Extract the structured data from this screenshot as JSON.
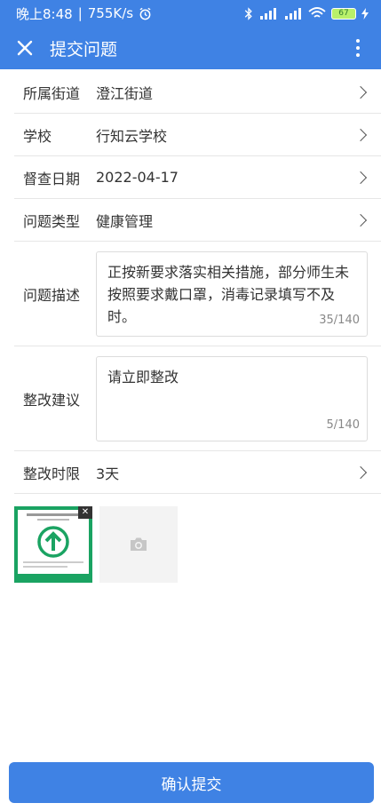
{
  "status_bar": {
    "time": "晚上8:48",
    "speed": "755K/s",
    "battery": "67"
  },
  "header": {
    "title": "提交问题"
  },
  "form": {
    "street": {
      "label": "所属街道",
      "value": "澄江街道"
    },
    "school": {
      "label": "学校",
      "value": "行知云学校"
    },
    "date": {
      "label": "督查日期",
      "value": "2022-04-17"
    },
    "type": {
      "label": "问题类型",
      "value": "健康管理"
    },
    "description": {
      "label": "问题描述",
      "value": "正按新要求落实相关措施，部分师生未按照要求戴口罩，消毒记录填写不及时。",
      "counter": "35/140"
    },
    "suggestion": {
      "label": "整改建议",
      "value": "请立即整改",
      "counter": "5/140"
    },
    "deadline": {
      "label": "整改时限",
      "value": "3天"
    }
  },
  "submit_label": "确认提交",
  "colors": {
    "primary": "#3f82e4",
    "thumb_green": "#1aa362"
  }
}
